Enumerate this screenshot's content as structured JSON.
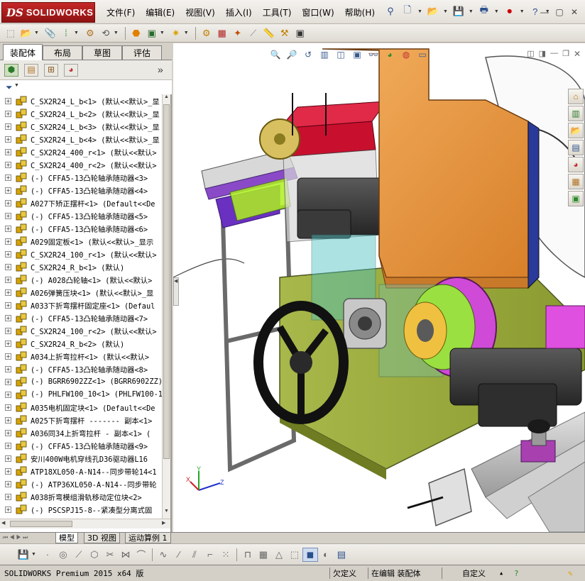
{
  "app": {
    "logo_text": "SOLIDWORKS",
    "menus": [
      "文件(F)",
      "编辑(E)",
      "视图(V)",
      "插入(I)",
      "工具(T)",
      "窗口(W)",
      "帮助(H)"
    ],
    "window_controls": [
      "—",
      "▢",
      "✕"
    ]
  },
  "panel": {
    "tabs": [
      "装配体",
      "布局",
      "草图",
      "评估"
    ],
    "active_tab": "装配体",
    "expand_glyph": "»",
    "filter_glyph": "▼"
  },
  "tree": [
    "C_SX2R24_L_b<1> (默认<<默认>_显",
    "C_SX2R24_L_b<2> (默认<<默认>_显",
    "C_SX2R24_L_b<3> (默认<<默认>_显",
    "C_SX2R24_L_b<4> (默认<<默认>_显",
    "C_SX2R24_400_r<1> (默认<<默认>",
    "C_SX2R24_400_r<2> (默认<<默认>",
    "(-) CFFA5-13凸轮轴承随动器<3>",
    "(-) CFFA5-13凸轮轴承随动器<4>",
    "A027下矫正摆杆<1> (Default<<De",
    "(-) CFFA5-13凸轮轴承随动器<5>",
    "(-) CFFA5-13凸轮轴承随动器<6>",
    "A029固定板<1> (默认<<默认>_显示",
    "C_SX2R24_100_r<1> (默认<<默认>",
    "C_SX2R24_R_b<1> (默认)",
    "(-) A028凸轮轴<1> (默认<<默认>",
    "A026弹簧压块<1> (默认<<默认>_显",
    "A033下折弯摆杆固定座<1> (Defaul",
    "(-) CFFA5-13凸轮轴承随动器<7>",
    "C_SX2R24_100_r<2> (默认<<默认>",
    "C_SX2R24_R_b<2> (默认)",
    "A034上折弯拉杆<1> (默认<<默认>",
    "(-) CFFA5-13凸轮轴承随动器<8>",
    "(-) BGRR6902ZZ<1> (BGRR6902ZZ)",
    "(-) PHLFW100_10<1> (PHLFW100-1",
    "A035电机固定块<1> (Default<<De",
    "A025下折弯摆杆 ------- 副本<1>",
    "A036同34上折弯拉杆 - 副本<1> (",
    "(-) CFFA5-13凸轮轴承随动器<9>",
    "安川400W电机穿线孔D36驱动器L16",
    "ATP18XL050-A-N14--同步带轮14<1",
    "(-) ATP36XL050-A-N14--同步带轮",
    "A038折弯模组滑轨移动定位块<2>",
    "(-) PSCSPJ15-8--紧凑型分离式固"
  ],
  "bottom_tabs": [
    "模型",
    "3D 视图",
    "运动算例 1"
  ],
  "active_bottom_tab": "模型",
  "status": {
    "product": "SOLIDWORKS Premium 2015 x64 版",
    "constraint": "欠定义",
    "mode": "在编辑 装配体",
    "custom": "自定义"
  },
  "colors": {
    "housing_orange": "#e8953a",
    "base_plate": "#9aaa3a",
    "bracket_red": "#c8102e",
    "pulley_magenta": "#c84ad8",
    "logo_red": "#b71c1c"
  }
}
